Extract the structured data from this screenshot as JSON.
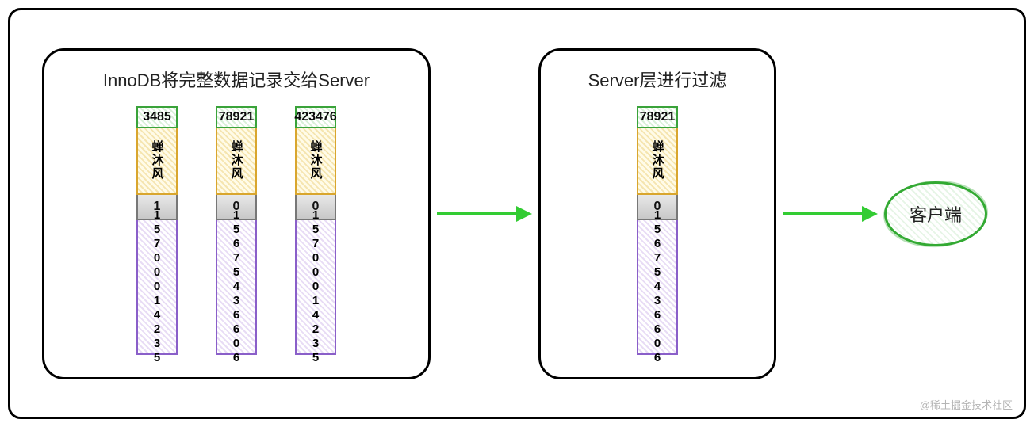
{
  "left_box": {
    "title": "InnoDB将完整数据记录交给Server",
    "records": [
      {
        "id": "3485",
        "name": "蝉沐风",
        "sex": "1",
        "phone": "15700014235"
      },
      {
        "id": "78921",
        "name": "蝉沐风",
        "sex": "0",
        "phone": "15675436606"
      },
      {
        "id": "423476",
        "name": "蝉沐风",
        "sex": "0",
        "phone": "15700014235"
      }
    ]
  },
  "right_box": {
    "title": "Server层进行过滤",
    "records": [
      {
        "id": "78921",
        "name": "蝉沐风",
        "sex": "0",
        "phone": "15675436606"
      }
    ]
  },
  "client": {
    "label": "客户端"
  },
  "watermark": "@稀土掘金技术社区"
}
